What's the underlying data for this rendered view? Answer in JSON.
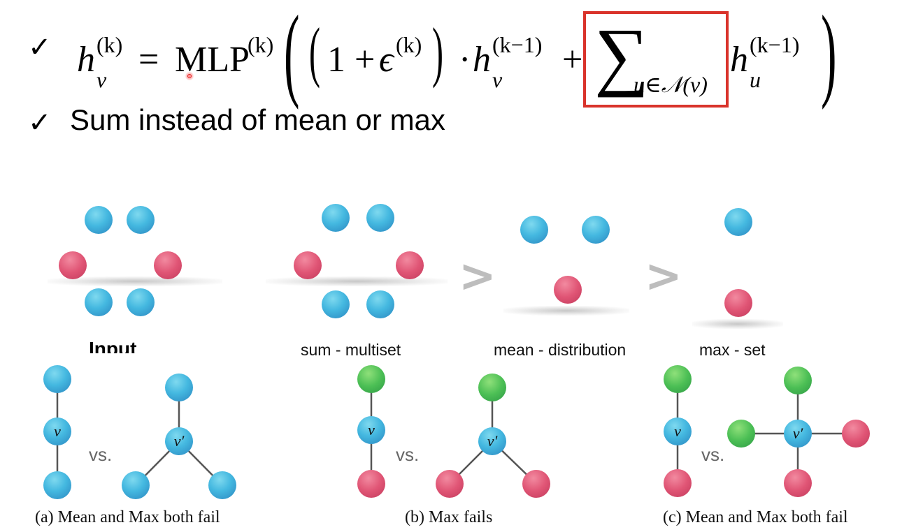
{
  "formula": {
    "check": "✓",
    "h": "h",
    "v_sub": "v",
    "k_sup": "(k)",
    "equals": "=",
    "mlp": "MLP",
    "mlp_sup": "(k)",
    "open_paren": "(",
    "one_plus": "1 +",
    "epsilon": "ϵ",
    "eps_sup": "(k)",
    "close_paren": ")",
    "dot": "·",
    "km1_sup": "(k−1)",
    "plus": "+",
    "sum": "∑",
    "sum_sub": "u∈𝒩(v)",
    "u_sub": "u"
  },
  "bullet": {
    "check": "✓",
    "text": "Sum instead of mean or max"
  },
  "aggregators": {
    "gt_symbol": ">",
    "input_label": "Input",
    "labels": [
      "sum - multiset",
      "mean - distribution",
      "max - set"
    ]
  },
  "examples": {
    "vs_label": "vs.",
    "node_v": "v",
    "node_v_prime": "v′",
    "captions": [
      "(a) Mean and Max both fail",
      "(b) Max fails",
      "(c) Mean and Max both fail"
    ]
  },
  "colors": {
    "highlight_box": "#d9332b",
    "blue_node": "#44b8e0",
    "red_node": "#e05575",
    "green_node": "#4cbf55"
  }
}
